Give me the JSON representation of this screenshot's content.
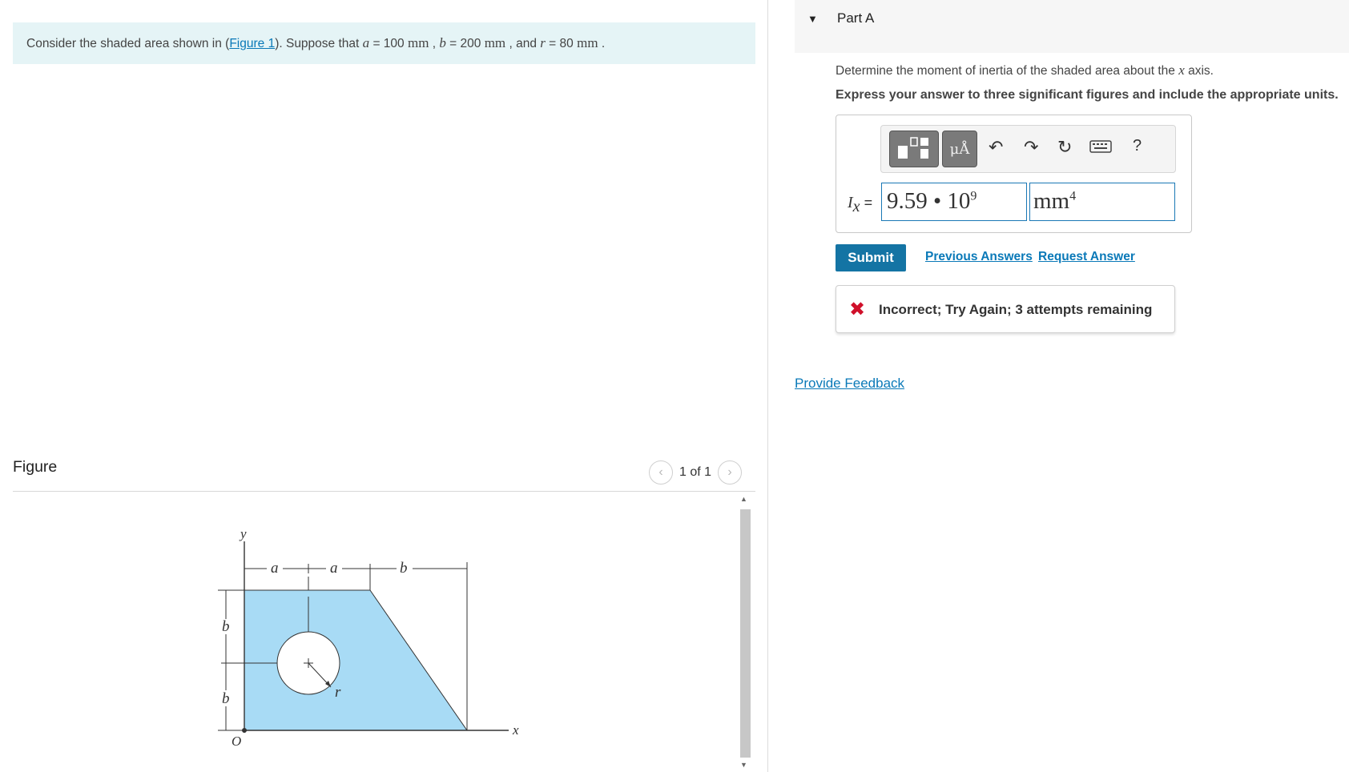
{
  "problem": {
    "text_before": "Consider the shaded area shown in (",
    "figure_link": "Figure 1",
    "text_mid": "). Suppose that ",
    "a_sym": "a",
    "a_val": " = 100 ",
    "a_unit": "mm",
    "sep1": " , ",
    "b_sym": "b",
    "b_val": " = 200 ",
    "b_unit": "mm",
    "sep2": " , and ",
    "r_sym": "r",
    "r_val": " = 80 ",
    "r_unit": "mm",
    "end": " ."
  },
  "figure": {
    "heading": "Figure",
    "pager": "1 of 1",
    "prev_icon": "chevron-left-icon",
    "next_icon": "chevron-right-icon",
    "labels": {
      "y": "y",
      "x": "x",
      "origin": "O",
      "a1": "a",
      "a2": "a",
      "b_top": "b",
      "b_left1": "b",
      "b_left2": "b",
      "r": "r"
    },
    "shape_fill": "#a8dbf5"
  },
  "part": {
    "title": "Part A",
    "toggle_icon": "caret-down-icon"
  },
  "instructions": {
    "line1_before": "Determine the moment of inertia of the shaded area about the ",
    "line1_axis": "x",
    "line1_after": " axis.",
    "line2": "Express your answer to three significant figures and include the appropriate units."
  },
  "toolbar": {
    "templates_icon": "templates-icon",
    "units_label": "μÅ",
    "undo_icon": "undo-icon",
    "redo_icon": "redo-icon",
    "reset_icon": "reset-icon",
    "keyboard_icon": "keyboard-icon",
    "help_label": "?"
  },
  "answer": {
    "label_sym": "I",
    "label_sub": "x",
    "label_eq": " =",
    "value_mantissa": "9.59 • 10",
    "value_exp": "9",
    "unit_base": "mm",
    "unit_exp": "4"
  },
  "actions": {
    "submit": "Submit",
    "previous_answers": "Previous Answers",
    "request_answer": "Request Answer"
  },
  "feedback": {
    "icon": "x-icon",
    "message": "Incorrect; Try Again; 3 attempts remaining"
  },
  "provide_feedback": "Provide Feedback",
  "colors": {
    "link": "#0a79b8",
    "submit_bg": "#1474a4",
    "problem_bg": "#e5f4f6",
    "error": "#d0102a"
  }
}
